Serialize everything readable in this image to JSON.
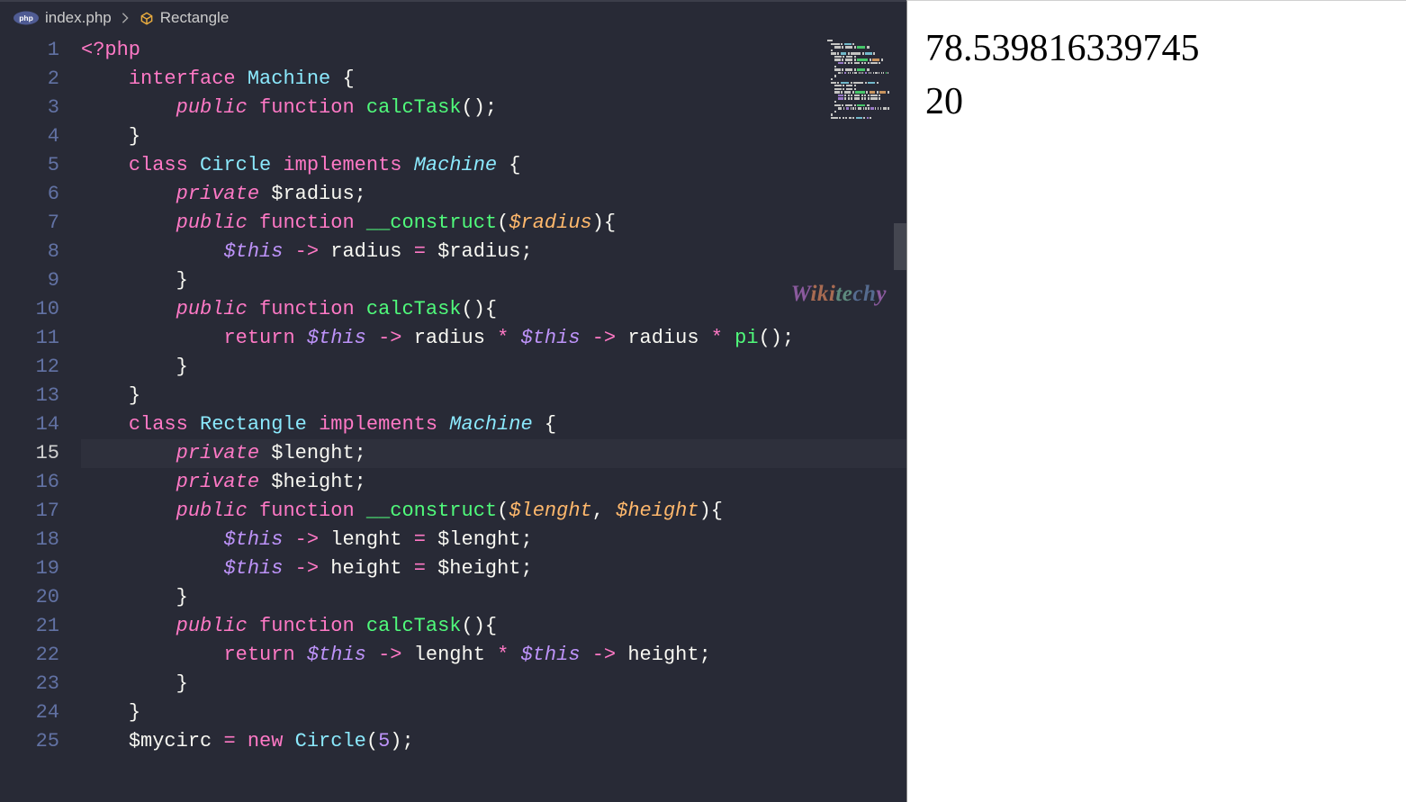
{
  "breadcrumb": {
    "file": "index.php",
    "symbol": "Rectangle"
  },
  "watermark": "Wikitechy",
  "activeLine": 15,
  "lineNumbers": [
    "1",
    "2",
    "3",
    "4",
    "5",
    "6",
    "7",
    "8",
    "9",
    "10",
    "11",
    "12",
    "13",
    "14",
    "15",
    "16",
    "17",
    "18",
    "19",
    "20",
    "21",
    "22",
    "23",
    "24",
    "25"
  ],
  "code": {
    "lines": [
      [
        {
          "t": "tag",
          "v": "<?php"
        }
      ],
      [
        {
          "indent": 1
        },
        {
          "t": "keyword",
          "v": "interface"
        },
        {
          "t": "punct",
          "v": " "
        },
        {
          "t": "class",
          "v": "Machine"
        },
        {
          "t": "punct",
          "v": " {"
        }
      ],
      [
        {
          "indent": 2
        },
        {
          "t": "storage",
          "v": "public"
        },
        {
          "t": "punct",
          "v": " "
        },
        {
          "t": "keyword",
          "v": "function"
        },
        {
          "t": "punct",
          "v": " "
        },
        {
          "t": "func",
          "v": "calcTask"
        },
        {
          "t": "punct",
          "v": "();"
        }
      ],
      [
        {
          "indent": 1
        },
        {
          "t": "punct",
          "v": "}"
        }
      ],
      [
        {
          "indent": 1
        },
        {
          "t": "keyword",
          "v": "class"
        },
        {
          "t": "punct",
          "v": " "
        },
        {
          "t": "class",
          "v": "Circle"
        },
        {
          "t": "punct",
          "v": " "
        },
        {
          "t": "keyword",
          "v": "implements"
        },
        {
          "t": "punct",
          "v": " "
        },
        {
          "t": "type",
          "v": "Machine"
        },
        {
          "t": "punct",
          "v": " {"
        }
      ],
      [
        {
          "indent": 2
        },
        {
          "t": "storage",
          "v": "private"
        },
        {
          "t": "punct",
          "v": " "
        },
        {
          "t": "var",
          "v": "$radius"
        },
        {
          "t": "punct",
          "v": ";"
        }
      ],
      [
        {
          "indent": 2
        },
        {
          "t": "storage",
          "v": "public"
        },
        {
          "t": "punct",
          "v": " "
        },
        {
          "t": "keyword",
          "v": "function"
        },
        {
          "t": "punct",
          "v": " "
        },
        {
          "t": "func",
          "v": "__construct"
        },
        {
          "t": "punct",
          "v": "("
        },
        {
          "t": "param",
          "v": "$radius"
        },
        {
          "t": "punct",
          "v": "){"
        }
      ],
      [
        {
          "indent": 3
        },
        {
          "t": "this",
          "v": "$this"
        },
        {
          "t": "punct",
          "v": " "
        },
        {
          "t": "op",
          "v": "->"
        },
        {
          "t": "punct",
          "v": " "
        },
        {
          "t": "prop",
          "v": "radius"
        },
        {
          "t": "punct",
          "v": " "
        },
        {
          "t": "op",
          "v": "="
        },
        {
          "t": "punct",
          "v": " "
        },
        {
          "t": "var",
          "v": "$radius"
        },
        {
          "t": "punct",
          "v": ";"
        }
      ],
      [
        {
          "indent": 2
        },
        {
          "t": "punct",
          "v": "}"
        }
      ],
      [
        {
          "indent": 2
        },
        {
          "t": "storage",
          "v": "public"
        },
        {
          "t": "punct",
          "v": " "
        },
        {
          "t": "keyword",
          "v": "function"
        },
        {
          "t": "punct",
          "v": " "
        },
        {
          "t": "func",
          "v": "calcTask"
        },
        {
          "t": "punct",
          "v": "(){"
        }
      ],
      [
        {
          "indent": 3
        },
        {
          "t": "keyword",
          "v": "return"
        },
        {
          "t": "punct",
          "v": " "
        },
        {
          "t": "this",
          "v": "$this"
        },
        {
          "t": "punct",
          "v": " "
        },
        {
          "t": "op",
          "v": "->"
        },
        {
          "t": "punct",
          "v": " "
        },
        {
          "t": "prop",
          "v": "radius"
        },
        {
          "t": "punct",
          "v": " "
        },
        {
          "t": "op",
          "v": "*"
        },
        {
          "t": "punct",
          "v": " "
        },
        {
          "t": "this",
          "v": "$this"
        },
        {
          "t": "punct",
          "v": " "
        },
        {
          "t": "op",
          "v": "->"
        },
        {
          "t": "punct",
          "v": " "
        },
        {
          "t": "prop",
          "v": "radius"
        },
        {
          "t": "punct",
          "v": " "
        },
        {
          "t": "op",
          "v": "*"
        },
        {
          "t": "punct",
          "v": " "
        },
        {
          "t": "func",
          "v": "pi"
        },
        {
          "t": "punct",
          "v": "();"
        }
      ],
      [
        {
          "indent": 2
        },
        {
          "t": "punct",
          "v": "}"
        }
      ],
      [
        {
          "indent": 1
        },
        {
          "t": "punct",
          "v": "}"
        }
      ],
      [
        {
          "indent": 1
        },
        {
          "t": "keyword",
          "v": "class"
        },
        {
          "t": "punct",
          "v": " "
        },
        {
          "t": "class",
          "v": "Rectangle"
        },
        {
          "t": "punct",
          "v": " "
        },
        {
          "t": "keyword",
          "v": "implements"
        },
        {
          "t": "punct",
          "v": " "
        },
        {
          "t": "type",
          "v": "Machine"
        },
        {
          "t": "punct",
          "v": " {"
        }
      ],
      [
        {
          "indent": 2
        },
        {
          "t": "storage",
          "v": "private"
        },
        {
          "t": "punct",
          "v": " "
        },
        {
          "t": "var",
          "v": "$lenght"
        },
        {
          "t": "punct",
          "v": ";"
        }
      ],
      [
        {
          "indent": 2
        },
        {
          "t": "storage",
          "v": "private"
        },
        {
          "t": "punct",
          "v": " "
        },
        {
          "t": "var",
          "v": "$height"
        },
        {
          "t": "punct",
          "v": ";"
        }
      ],
      [
        {
          "indent": 2
        },
        {
          "t": "storage",
          "v": "public"
        },
        {
          "t": "punct",
          "v": " "
        },
        {
          "t": "keyword",
          "v": "function"
        },
        {
          "t": "punct",
          "v": " "
        },
        {
          "t": "func",
          "v": "__construct"
        },
        {
          "t": "punct",
          "v": "("
        },
        {
          "t": "param",
          "v": "$lenght"
        },
        {
          "t": "punct",
          "v": ", "
        },
        {
          "t": "param",
          "v": "$height"
        },
        {
          "t": "punct",
          "v": "){"
        }
      ],
      [
        {
          "indent": 3
        },
        {
          "t": "this",
          "v": "$this"
        },
        {
          "t": "punct",
          "v": " "
        },
        {
          "t": "op",
          "v": "->"
        },
        {
          "t": "punct",
          "v": " "
        },
        {
          "t": "prop",
          "v": "lenght"
        },
        {
          "t": "punct",
          "v": " "
        },
        {
          "t": "op",
          "v": "="
        },
        {
          "t": "punct",
          "v": " "
        },
        {
          "t": "var",
          "v": "$lenght"
        },
        {
          "t": "punct",
          "v": ";"
        }
      ],
      [
        {
          "indent": 3
        },
        {
          "t": "this",
          "v": "$this"
        },
        {
          "t": "punct",
          "v": " "
        },
        {
          "t": "op",
          "v": "->"
        },
        {
          "t": "punct",
          "v": " "
        },
        {
          "t": "prop",
          "v": "height"
        },
        {
          "t": "punct",
          "v": " "
        },
        {
          "t": "op",
          "v": "="
        },
        {
          "t": "punct",
          "v": " "
        },
        {
          "t": "var",
          "v": "$height"
        },
        {
          "t": "punct",
          "v": ";"
        }
      ],
      [
        {
          "indent": 2
        },
        {
          "t": "punct",
          "v": "}"
        }
      ],
      [
        {
          "indent": 2
        },
        {
          "t": "storage",
          "v": "public"
        },
        {
          "t": "punct",
          "v": " "
        },
        {
          "t": "keyword",
          "v": "function"
        },
        {
          "t": "punct",
          "v": " "
        },
        {
          "t": "func",
          "v": "calcTask"
        },
        {
          "t": "punct",
          "v": "(){"
        }
      ],
      [
        {
          "indent": 3
        },
        {
          "t": "keyword",
          "v": "return"
        },
        {
          "t": "punct",
          "v": " "
        },
        {
          "t": "this",
          "v": "$this"
        },
        {
          "t": "punct",
          "v": " "
        },
        {
          "t": "op",
          "v": "->"
        },
        {
          "t": "punct",
          "v": " "
        },
        {
          "t": "prop",
          "v": "lenght"
        },
        {
          "t": "punct",
          "v": " "
        },
        {
          "t": "op",
          "v": "*"
        },
        {
          "t": "punct",
          "v": " "
        },
        {
          "t": "this",
          "v": "$this"
        },
        {
          "t": "punct",
          "v": " "
        },
        {
          "t": "op",
          "v": "->"
        },
        {
          "t": "punct",
          "v": " "
        },
        {
          "t": "prop",
          "v": "height"
        },
        {
          "t": "punct",
          "v": ";"
        }
      ],
      [
        {
          "indent": 2
        },
        {
          "t": "punct",
          "v": "}"
        }
      ],
      [
        {
          "indent": 1
        },
        {
          "t": "punct",
          "v": "}"
        }
      ],
      [
        {
          "indent": 1
        },
        {
          "t": "var",
          "v": "$mycirc"
        },
        {
          "t": "punct",
          "v": " "
        },
        {
          "t": "op",
          "v": "="
        },
        {
          "t": "punct",
          "v": " "
        },
        {
          "t": "new",
          "v": "new"
        },
        {
          "t": "punct",
          "v": " "
        },
        {
          "t": "class",
          "v": "Circle"
        },
        {
          "t": "punct",
          "v": "("
        },
        {
          "t": "num",
          "v": "5"
        },
        {
          "t": "punct",
          "v": ");"
        }
      ]
    ]
  },
  "output": {
    "line1": "78.539816339745",
    "line2": "20"
  }
}
